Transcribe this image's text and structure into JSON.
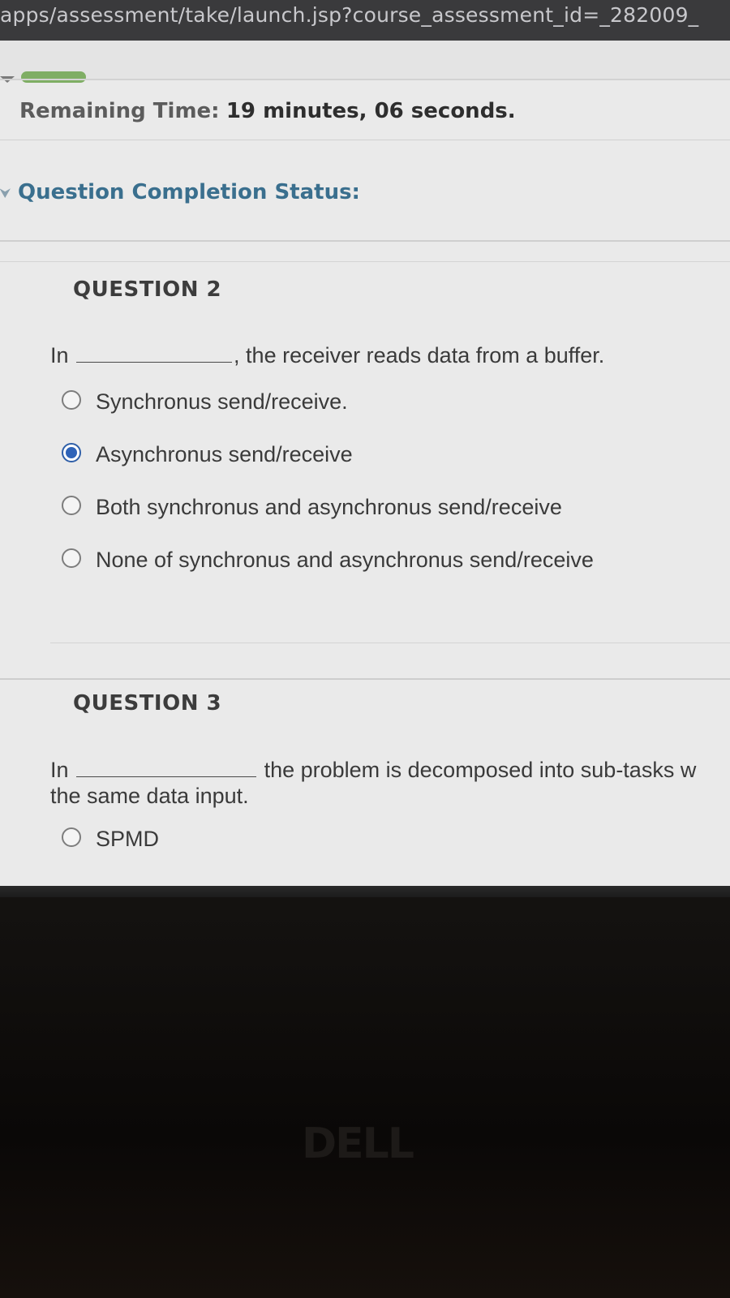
{
  "browser": {
    "url": "apps/assessment/take/launch.jsp?course_assessment_id=_282009_"
  },
  "timer": {
    "label": "Remaining Time:",
    "value": "19 minutes, 06 seconds."
  },
  "completion_status": {
    "label": "Question Completion Status:"
  },
  "questions": [
    {
      "title": "QUESTION 2",
      "text_before": "In",
      "text_after": ", the receiver reads data from a buffer.",
      "options": [
        {
          "label": "Synchronus send/receive.",
          "selected": false
        },
        {
          "label": "Asynchronus send/receive",
          "selected": true
        },
        {
          "label": "Both synchronus and asynchronus send/receive",
          "selected": false
        },
        {
          "label": "None of synchronus and asynchronus send/receive",
          "selected": false
        }
      ]
    },
    {
      "title": "QUESTION 3",
      "text_before": "In",
      "text_after": "the problem is decomposed into sub-tasks w",
      "text_line2": "the same data input.",
      "options": [
        {
          "label": "SPMD",
          "selected": false
        }
      ]
    }
  ],
  "device": {
    "brand_logo": "DELL"
  },
  "colors": {
    "status_label": "#3a6f8e",
    "radio_selected": "#2e63b8",
    "progress_pill": "#7fae64"
  }
}
